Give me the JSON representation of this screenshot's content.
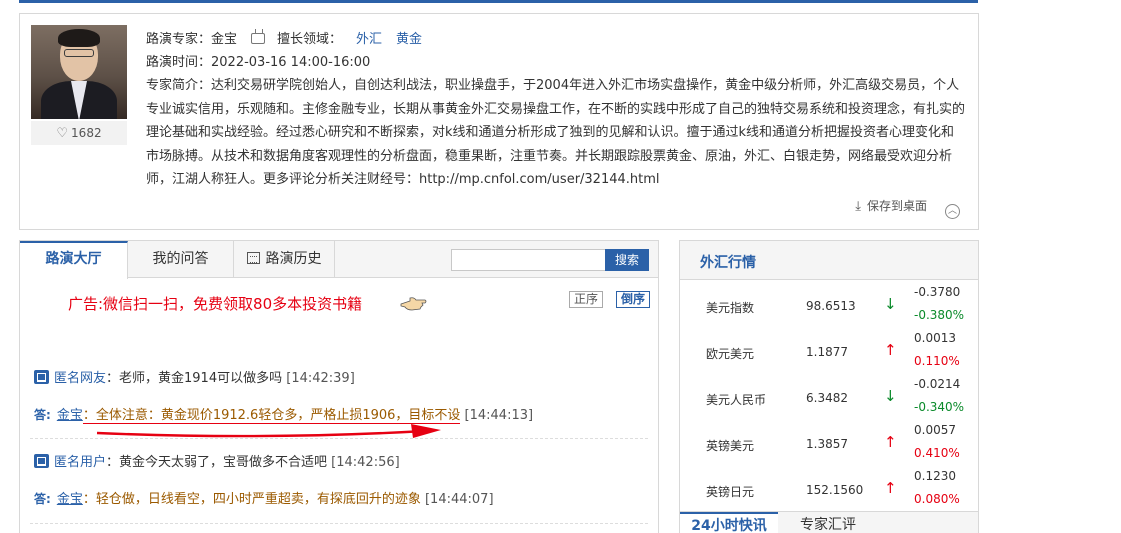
{
  "expert": {
    "name_line": "路演专家：金宝",
    "specialty_label": "擅长领域：",
    "specialties": [
      "外汇",
      "黄金"
    ],
    "time_line": "路演时间：2022-03-16 14:00-16:00",
    "bio": "专家简介：达利交易研学院创始人，自创达利战法，职业操盘手，于2004年进入外汇市场实盘操作，黄金中级分析师，外汇高级交易员，个人专业诚实信用，乐观随和。主修金融专业，长期从事黄金外汇交易操盘工作，在不断的实践中形成了自己的独特交易系统和投资理念，有扎实的理论基础和实战经验。经过悉心研究和不断探索，对k线和通道分析形成了独到的见解和认识。擅于通过k线和通道分析把握投资者心理变化和市场脉搏。从技术和数据角度客观理性的分析盘面，稳重果断，注重节奏。并长期跟踪股票黄金、原油，外汇、白银走势，网络最受欢迎分析师，江湖人称狂人。更多评论分析关注财经号：http://mp.cnfol.com/user/32144.html",
    "likes": "1682",
    "save_label": "保存到桌面",
    "icons": [
      "tv-icon",
      "heart-icon",
      "download-icon",
      "collapse-up-icon"
    ]
  },
  "hall": {
    "tabs": [
      "路演大厅",
      "我的问答",
      "路演历史"
    ],
    "search_placeholder": "",
    "search_label": "搜索",
    "ad_text": "广告:微信扫一扫，免费领取80多本投资书籍",
    "order_asc": "正序",
    "order_desc": "倒序",
    "answer_label": "答:",
    "items": [
      {
        "asker": "匿名网友",
        "question": "：老师，黄金1914可以做多吗",
        "q_time": "[14:42:39]",
        "answerer": "金宝",
        "answer": "：全体注意：黄金现价1912.6轻仓多，严格止损1906，目标不设",
        "a_time": "[14:44:13]"
      },
      {
        "asker": "匿名用户",
        "question": "：黄金今天太弱了，宝哥做多不合适吧",
        "q_time": "[14:42:56]",
        "answerer": "金宝",
        "answer": "：轻仓做，日线看空，四小时严重超卖，有探底回升的迹象",
        "a_time": "[14:44:07]"
      }
    ]
  },
  "fx": {
    "title": "外汇行情",
    "rows": [
      {
        "name": "美元指数",
        "value": "98.6513",
        "dir": "down",
        "change": "-0.3780",
        "pct": "-0.380%"
      },
      {
        "name": "欧元美元",
        "value": "1.1877",
        "dir": "up",
        "change": "0.0013",
        "pct": "0.110%"
      },
      {
        "name": "美元人民币",
        "value": "6.3482",
        "dir": "down",
        "change": "-0.0214",
        "pct": "-0.340%"
      },
      {
        "name": "英镑美元",
        "value": "1.3857",
        "dir": "up",
        "change": "0.0057",
        "pct": "0.410%"
      },
      {
        "name": "英镑日元",
        "value": "152.1560",
        "dir": "up",
        "change": "0.1230",
        "pct": "0.080%"
      }
    ],
    "bottom_tabs": [
      "24小时快讯",
      "专家汇评"
    ],
    "colors": {
      "up": "#e60012",
      "down": "#0a8a2a",
      "accent": "#2b61a8"
    }
  }
}
